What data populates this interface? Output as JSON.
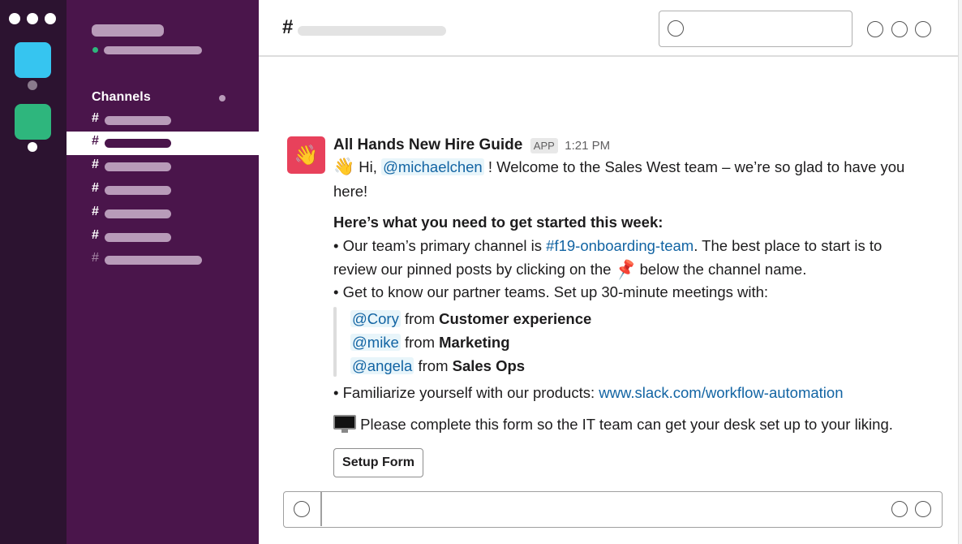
{
  "header": {
    "hash": "#"
  },
  "sidebar": {
    "channels_label": "Channels",
    "hash": "#"
  },
  "message": {
    "avatar_emoji": "👋",
    "sender": "All Hands New Hire Guide",
    "badge": "APP",
    "time": "1:21 PM",
    "greeting_emoji": "👋",
    "hi": "Hi,",
    "mention_user": "@michaelchen",
    "welcome": "! Welcome to the Sales West team – we’re so glad to have you",
    "welcome_cont": "here!",
    "heading": "Here’s what you need to get started this week:",
    "bullet1_a": "• Our team’s primary channel is ",
    "bullet1_channel": "#f19-onboarding-team",
    "bullet1_b": ". The best place to start is to",
    "bullet1_c": "review our pinned posts by clicking on the",
    "pin_emoji": "📌",
    "bullet1_d": "below the channel name.",
    "bullet2": "• Get to know our partner teams. Set up 30-minute meetings with:",
    "contacts": [
      {
        "mention": "@Cory",
        "from": "from",
        "team": "Customer experience"
      },
      {
        "mention": "@mike",
        "from": "from",
        "team": "Marketing"
      },
      {
        "mention": "@angela",
        "from": "from",
        "team": "Sales Ops"
      }
    ],
    "bullet3": "• Familiarize yourself with our products:",
    "bullet3_link": "www.slack.com/workflow-automation",
    "form_text": "Please complete this form so the IT team can get your desk set up to your liking.",
    "button_label": "Setup Form"
  },
  "colors": {
    "rail": "#2c1330",
    "sidebar": "#4a154b",
    "workspace_1": "#36c5f0",
    "workspace_2": "#2eb67d",
    "avatar_bg": "#e8415b",
    "link": "#1264a3"
  }
}
